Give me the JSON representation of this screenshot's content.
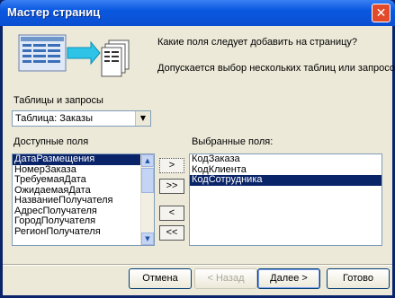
{
  "window": {
    "title": "Мастер страниц",
    "close_symbol": "✕"
  },
  "illustration": {
    "name": "wizard-illustration"
  },
  "prompt": {
    "question": "Какие поля следует добавить на страницу?",
    "hint": "Допускается выбор нескольких таблиц или запросов."
  },
  "tables": {
    "label": "Таблицы и запросы",
    "selected": "Таблица: Заказы",
    "arrow": "▼"
  },
  "available": {
    "label": "Доступные поля",
    "items": [
      "ДатаРазмещения",
      "НомерЗаказа",
      "ТребуемаяДата",
      "ОжидаемаяДата",
      "НазваниеПолучателя",
      "АдресПолучателя",
      "ГородПолучателя",
      "РегионПолучателя"
    ],
    "selected_index": 0
  },
  "selected": {
    "label": "Выбранные поля:",
    "items": [
      "КодЗаказа",
      "КодКлиента",
      "КодСотрудника"
    ],
    "selected_index": 2
  },
  "move_buttons": {
    "add": ">",
    "add_all": ">>",
    "remove": "<",
    "remove_all": "<<"
  },
  "footer": {
    "cancel": "Отмена",
    "back": "< Назад",
    "next": "Далее >",
    "finish": "Готово"
  },
  "scroll": {
    "up": "▲",
    "down": "▼"
  },
  "colors": {
    "title_bar": "#0a58e0",
    "selection": "#0a246a",
    "dialog_bg": "#ece9d8"
  }
}
